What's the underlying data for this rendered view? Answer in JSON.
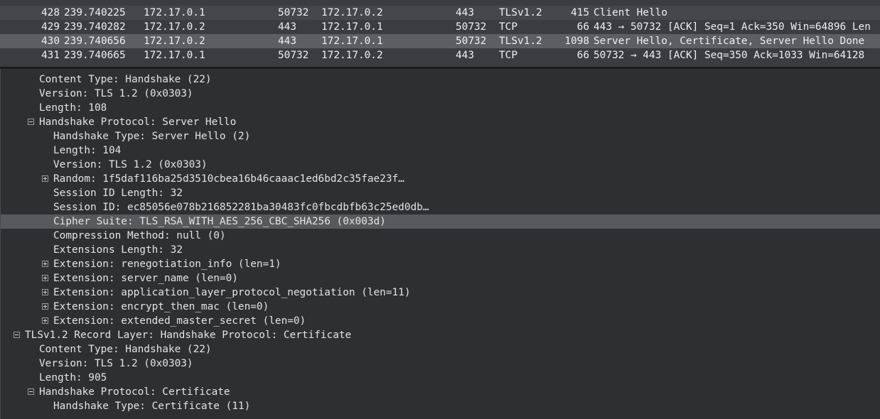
{
  "packets": [
    {
      "no": "428",
      "time": "239.740225",
      "src": "172.17.0.1",
      "sport": "50732",
      "dst": "172.17.0.2",
      "dport": "443",
      "proto": "TLSv1.2",
      "len": "415",
      "info": "Client Hello"
    },
    {
      "no": "429",
      "time": "239.740282",
      "src": "172.17.0.2",
      "sport": "443",
      "dst": "172.17.0.1",
      "dport": "50732",
      "proto": "TCP",
      "len": "66",
      "info": "443 → 50732 [ACK] Seq=1 Ack=350 Win=64896 Len"
    },
    {
      "no": "430",
      "time": "239.740656",
      "src": "172.17.0.2",
      "sport": "443",
      "dst": "172.17.0.1",
      "dport": "50732",
      "proto": "TLSv1.2",
      "len": "1098",
      "info": "Server Hello, Certificate, Server Hello Done"
    },
    {
      "no": "431",
      "time": "239.740665",
      "src": "172.17.0.1",
      "sport": "50732",
      "dst": "172.17.0.2",
      "dport": "443",
      "proto": "TCP",
      "len": "66",
      "info": "50732 → 443 [ACK] Seq=350 Ack=1033 Win=64128"
    }
  ],
  "selected_packet": "430",
  "details": [
    {
      "text": "Content Type: Handshake (22)",
      "level": 2,
      "toggle": "none"
    },
    {
      "text": "Version: TLS 1.2 (0x0303)",
      "level": 2,
      "toggle": "none"
    },
    {
      "text": "Length: 108",
      "level": 2,
      "toggle": "none"
    },
    {
      "text": "Handshake Protocol: Server Hello",
      "level": 2,
      "toggle": "minus"
    },
    {
      "text": "Handshake Type: Server Hello (2)",
      "level": 3,
      "toggle": "none"
    },
    {
      "text": "Length: 104",
      "level": 3,
      "toggle": "none"
    },
    {
      "text": "Version: TLS 1.2 (0x0303)",
      "level": 3,
      "toggle": "none"
    },
    {
      "text": "Random: 1f5daf116ba25d3510cbea16b46caaac1ed6bd2c35fae23f…",
      "level": 3,
      "toggle": "plus"
    },
    {
      "text": "Session ID Length: 32",
      "level": 3,
      "toggle": "none"
    },
    {
      "text": "Session ID: ec85056e078b216852281ba30483fc0fbcdbfb63c25ed0db…",
      "level": 3,
      "toggle": "none"
    },
    {
      "text": "Cipher Suite: TLS_RSA_WITH_AES_256_CBC_SHA256 (0x003d)",
      "level": 3,
      "toggle": "none",
      "selected": true
    },
    {
      "text": "Compression Method: null (0)",
      "level": 3,
      "toggle": "none"
    },
    {
      "text": "Extensions Length: 32",
      "level": 3,
      "toggle": "none"
    },
    {
      "text": "Extension: renegotiation_info (len=1)",
      "level": 3,
      "toggle": "plus"
    },
    {
      "text": "Extension: server_name (len=0)",
      "level": 3,
      "toggle": "plus"
    },
    {
      "text": "Extension: application_layer_protocol_negotiation (len=11)",
      "level": 3,
      "toggle": "plus"
    },
    {
      "text": "Extension: encrypt_then_mac (len=0)",
      "level": 3,
      "toggle": "plus"
    },
    {
      "text": "Extension: extended_master_secret (len=0)",
      "level": 3,
      "toggle": "plus"
    },
    {
      "text": "TLSv1.2 Record Layer: Handshake Protocol: Certificate",
      "level": 1,
      "toggle": "minus"
    },
    {
      "text": "Content Type: Handshake (22)",
      "level": 2,
      "toggle": "none"
    },
    {
      "text": "Version: TLS 1.2 (0x0303)",
      "level": 2,
      "toggle": "none"
    },
    {
      "text": "Length: 905",
      "level": 2,
      "toggle": "none"
    },
    {
      "text": "Handshake Protocol: Certificate",
      "level": 2,
      "toggle": "minus"
    },
    {
      "text": "Handshake Type: Certificate (11)",
      "level": 3,
      "toggle": "none"
    }
  ]
}
